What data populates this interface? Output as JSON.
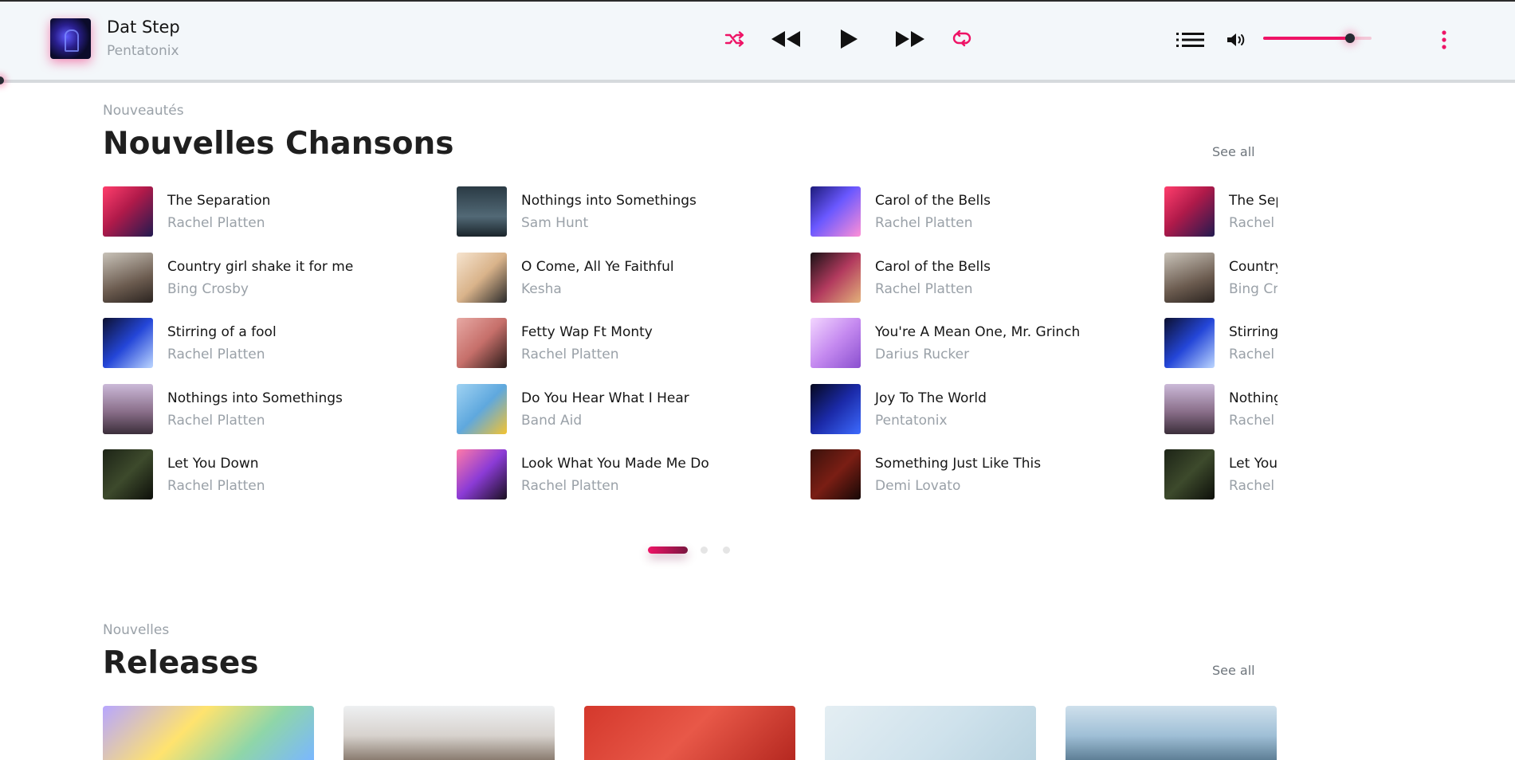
{
  "player": {
    "now_playing": {
      "title": "Dat Step",
      "artist": "Pentatonix"
    },
    "controls": [
      "shuffle-icon",
      "rewind-icon",
      "play-icon",
      "fast-forward-icon",
      "repeat-icon",
      "queue-list-icon",
      "volume-icon",
      "more-vertical-icon"
    ],
    "volume_level": 0.8,
    "progress_level": 0.0,
    "accent_color": "#ee1466"
  },
  "new_songs": {
    "eyebrow": "Nouveautés",
    "title": "Nouvelles Chansons",
    "see_all": "See all",
    "columns": [
      [
        {
          "title": "The Separation",
          "artist": "Rachel Platten"
        },
        {
          "title": "Country girl shake it for me",
          "artist": "Bing Crosby"
        },
        {
          "title": "Stirring of a fool",
          "artist": "Rachel Platten"
        },
        {
          "title": "Nothings into Somethings",
          "artist": "Rachel Platten"
        },
        {
          "title": "Let You Down",
          "artist": "Rachel Platten"
        }
      ],
      [
        {
          "title": "Nothings into Somethings",
          "artist": "Sam Hunt"
        },
        {
          "title": "O Come, All Ye Faithful",
          "artist": "Kesha"
        },
        {
          "title": "Fetty Wap Ft Monty",
          "artist": "Rachel Platten"
        },
        {
          "title": "Do You Hear What I Hear",
          "artist": "Band Aid"
        },
        {
          "title": "Look What You Made Me Do",
          "artist": "Rachel Platten"
        }
      ],
      [
        {
          "title": "Carol of the Bells",
          "artist": "Rachel Platten"
        },
        {
          "title": "Carol of the Bells",
          "artist": "Rachel Platten"
        },
        {
          "title": "You're A Mean One, Mr. Grinch",
          "artist": "Darius Rucker"
        },
        {
          "title": "Joy To The World",
          "artist": "Pentatonix"
        },
        {
          "title": "Something Just Like This",
          "artist": "Demi Lovato"
        }
      ],
      [
        {
          "title": "The Separation",
          "artist": "Rachel Platten"
        },
        {
          "title": "Country girl shake it for me",
          "artist": "Bing Crosby"
        },
        {
          "title": "Stirring of a fool",
          "artist": "Rachel Platten"
        },
        {
          "title": "Nothings into Somethings",
          "artist": "Rachel Platten"
        },
        {
          "title": "Let You Down",
          "artist": "Rachel Platten"
        }
      ]
    ],
    "carousel": {
      "pages": 3,
      "active_page": 1
    }
  },
  "releases": {
    "eyebrow": "Nouvelles",
    "title": "Releases",
    "see_all": "See all",
    "card_count": 5
  }
}
